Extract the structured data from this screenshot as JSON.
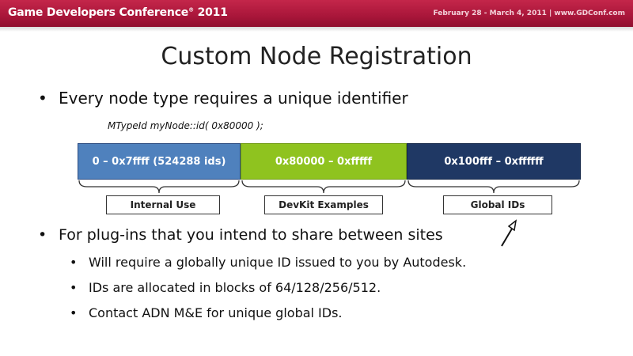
{
  "header": {
    "conference": "Game Developers Conference",
    "conference_mark": "®",
    "year": "2011",
    "dates": "February 28 - March 4, 2011 | www.GDConf.com"
  },
  "slide": {
    "title": "Custom Node Registration",
    "bullet1": "Every node type requires a unique identifier",
    "code": "MTypeId myNode::id( 0x80000 );",
    "segments": [
      {
        "label": "0 – 0x7ffff (524288 ids)",
        "color": "#4f81bd"
      },
      {
        "label": "0x80000 – 0xfffff",
        "color": "#8fc31f"
      },
      {
        "label": "0x100fff – 0xffffff",
        "color": "#1f3864"
      }
    ],
    "range_labels": [
      "Internal Use",
      "DevKit Examples",
      "Global IDs"
    ],
    "bullet2": "For plug-ins that you intend to share between sites",
    "sub_bullets": [
      "Will require a globally unique ID issued to you by Autodesk.",
      "IDs are allocated in blocks of 64/128/256/512.",
      "Contact ADN M&E for unique global IDs."
    ],
    "bullet_glyph": "•"
  }
}
